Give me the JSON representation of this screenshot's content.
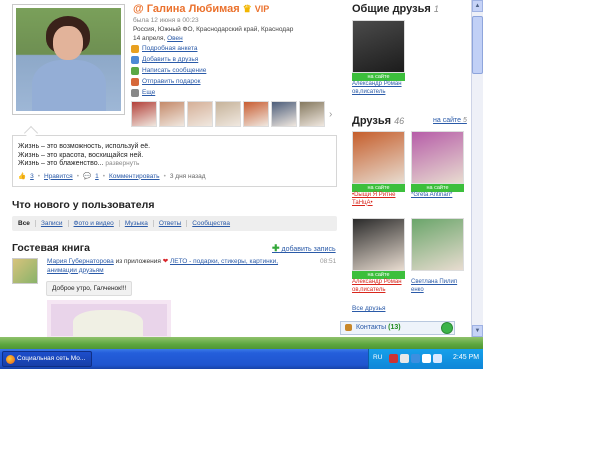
{
  "profile": {
    "name": "Галина Любимая",
    "vip": "VIP",
    "last_seen": "была 12 июня в 00:23",
    "location": "Россия, Южный ФО, Краснодарский край, Краснодар",
    "birthday": "14 апреля,",
    "zodiac": "Овен",
    "actions": [
      {
        "label": "Подробная анкета",
        "icon": "profile-icon",
        "color": "#e8a020"
      },
      {
        "label": "Добавить в друзья",
        "icon": "add-friend-icon",
        "color": "#4e8ad6"
      },
      {
        "label": "Написать сообщение",
        "icon": "message-icon",
        "color": "#5aa845"
      },
      {
        "label": "Отправить подарок",
        "icon": "gift-icon",
        "color": "#d6683a"
      },
      {
        "label": "Еще",
        "icon": "more-icon",
        "color": "#888888"
      }
    ],
    "friend_thumb_colors": [
      "#b3413a",
      "#c48a6a",
      "#d5b098",
      "#c6b39a",
      "#c85d32",
      "#4c5d7a",
      "#85795f"
    ]
  },
  "status": {
    "lines": [
      "Жизнь – это возможность, используй её.",
      "Жизнь – это красота, восхищайся ней.",
      "Жизнь – это блаженство..."
    ],
    "more_label": "развернуть",
    "likes_count": "3",
    "like_label": "Нравится",
    "comments_count": "1",
    "comment_label": "Комментировать",
    "time": "3 дня назад"
  },
  "whats_new": {
    "title": "Что нового у пользователя",
    "tabs": [
      "Все",
      "Записи",
      "Фото и видео",
      "Музыка",
      "Ответы",
      "Сообщества"
    ]
  },
  "guestbook": {
    "title": "Гостевая книга",
    "add_label": "добавить запись",
    "entry": {
      "author": "Мария Губернаторова",
      "from_text": "из приложения",
      "app_name": "ЛЕТО - подарки, стикеры, картинки, анимации друзьям",
      "time": "08:51",
      "message": "Доброе утро, Галченок!!!"
    }
  },
  "common_friends": {
    "title": "Общие друзья",
    "count": "1",
    "items": [
      {
        "name": "Александр Роман ов,писатель",
        "online": "на сайте",
        "color": "#2a2a2a"
      }
    ]
  },
  "friends": {
    "title": "Друзья",
    "count": "46",
    "online_link": "на сайте",
    "online_count": "5",
    "items": [
      {
        "name": "•Dыщи Я Ритне ТаНцА•",
        "online": "на сайте",
        "color": "#c55e2c",
        "red": true
      },
      {
        "name": "*Greta Antinari*",
        "online": "на сайте",
        "color": "#b65da8",
        "red": false
      },
      {
        "name": "Александр Роман ов,писатель",
        "online": "на сайте",
        "color": "#2a2a2a",
        "red": true
      },
      {
        "name": "Светлана Пилип енко",
        "online": "",
        "color": "#6aa56a",
        "red": false
      }
    ],
    "all_label": "Все друзья"
  },
  "contacts": {
    "label": "Контакты",
    "count": "(13)"
  },
  "taskbar": {
    "window_title": "Социальная сеть Мо...",
    "lang": "RU",
    "clock": "2:45 PM"
  }
}
